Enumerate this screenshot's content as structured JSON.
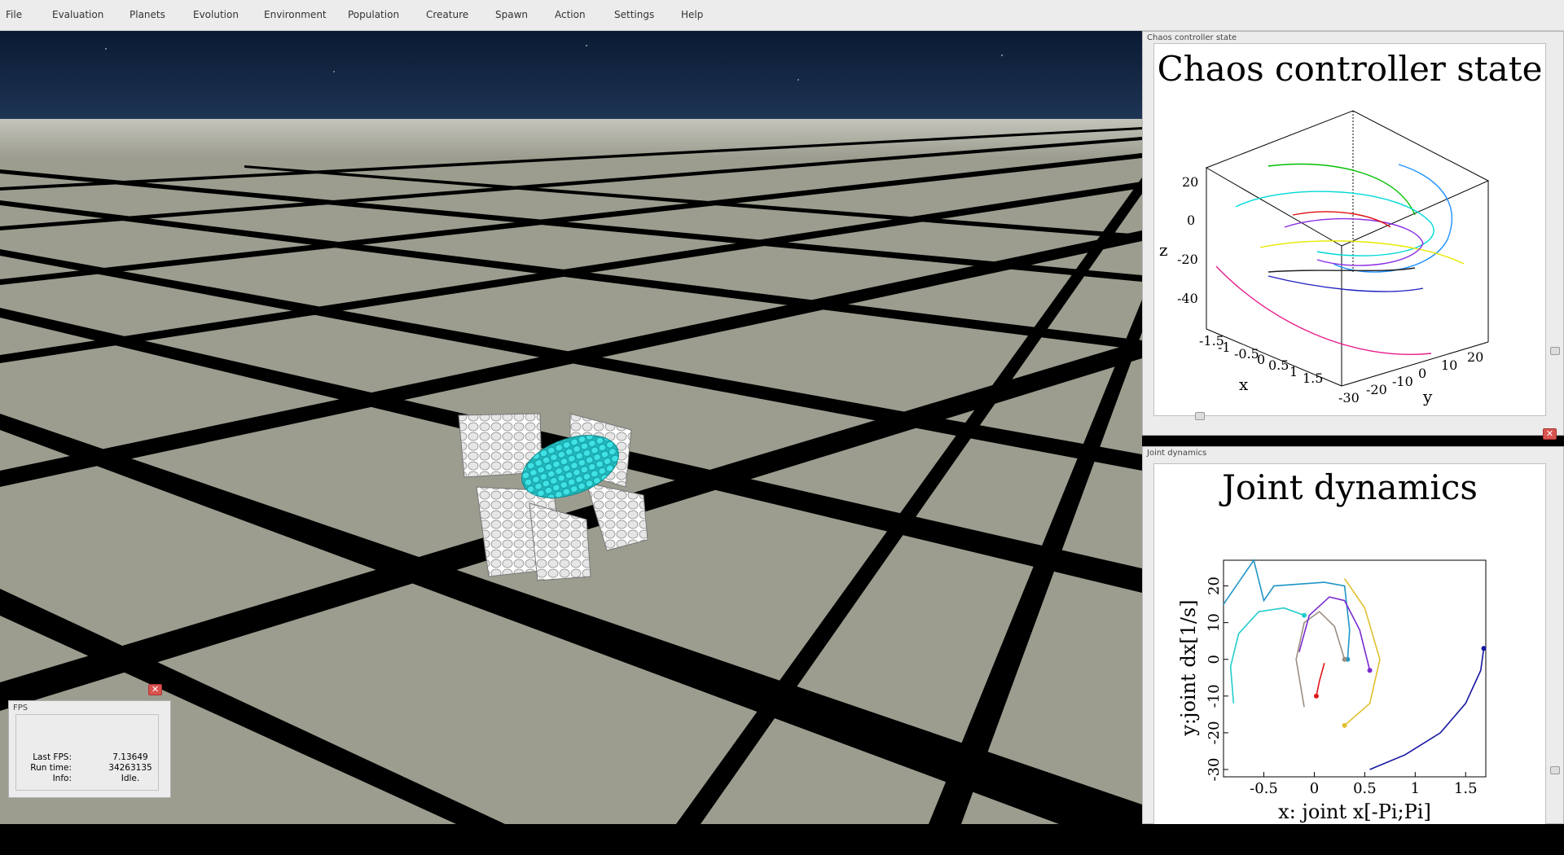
{
  "menu": {
    "items": [
      "File",
      "Evaluation",
      "Planets",
      "Evolution",
      "Environment",
      "Population",
      "Creature",
      "Spawn",
      "Action",
      "Settings",
      "Help"
    ]
  },
  "chaos_panel": {
    "window_title": "Chaos controller state",
    "plot_title": "Chaos controller state",
    "close_icon": "close-icon"
  },
  "joint_panel": {
    "window_title": "Joint dynamics",
    "plot_title": "Joint dynamics"
  },
  "fps_panel": {
    "title": "FPS",
    "rows": [
      {
        "label": "Last FPS:",
        "value": "7.13649"
      },
      {
        "label": "Run time:",
        "value": "34263135"
      },
      {
        "label": "Info:",
        "value": "Idle."
      }
    ]
  },
  "colors": {
    "floor": "#9c9d8f",
    "grid_lines": "#000000",
    "sky": "#0a1a33",
    "creature_body": "#2ec9cc",
    "panel_bg": "#ececec",
    "close_button": "#d9534f"
  },
  "chart_data": [
    {
      "type": "scatter",
      "title": "Chaos controller state",
      "projection": "3d",
      "xlabel": "x",
      "ylabel": "y",
      "zlabel": "z",
      "x_ticks": [
        "-1.5",
        "-1",
        "-0.5",
        "0",
        "0.5",
        "1",
        "1.5"
      ],
      "y_ticks": [
        "-30",
        "-20",
        "-10",
        "0",
        "10",
        "20"
      ],
      "z_ticks": [
        "20",
        "0",
        "-20",
        "-40"
      ],
      "grid": false,
      "series_colors": [
        "#00c000",
        "#1e90ff",
        "#e61e8c",
        "#00d8d8",
        "#e8e800",
        "#8a2be2",
        "#202020",
        "#1f1fbf",
        "#e01010"
      ]
    },
    {
      "type": "line",
      "title": "Joint dynamics",
      "xlabel": "x: joint x[-Pi;Pi]",
      "ylabel": "y:joint dx[1/s]",
      "xlim": [
        -0.9,
        1.7
      ],
      "ylim": [
        -32,
        27
      ],
      "x_ticks": [
        "-0.5",
        "0",
        "0.5",
        "1",
        "1.5"
      ],
      "y_ticks": [
        "20",
        "10",
        "0",
        "-10",
        "-20",
        "-30"
      ],
      "grid": false,
      "series": [
        {
          "color": "#1f96c8",
          "points": [
            [
              -0.9,
              15
            ],
            [
              -0.6,
              27
            ],
            [
              -0.5,
              16
            ],
            [
              -0.4,
              20
            ],
            [
              0.1,
              21
            ],
            [
              0.3,
              20
            ],
            [
              0.35,
              8
            ],
            [
              0.33,
              0
            ]
          ]
        },
        {
          "color": "#22cccc",
          "points": [
            [
              -0.8,
              -12
            ],
            [
              -0.83,
              -2
            ],
            [
              -0.75,
              7
            ],
            [
              -0.55,
              13
            ],
            [
              -0.3,
              14
            ],
            [
              -0.1,
              12
            ]
          ]
        },
        {
          "color": "#9a8f80",
          "points": [
            [
              -0.1,
              -13
            ],
            [
              -0.18,
              0
            ],
            [
              -0.1,
              10
            ],
            [
              0.05,
              13
            ],
            [
              0.2,
              9
            ],
            [
              0.3,
              0
            ]
          ]
        },
        {
          "color": "#7a2bd0",
          "points": [
            [
              -0.15,
              2
            ],
            [
              -0.05,
              12
            ],
            [
              0.15,
              17
            ],
            [
              0.3,
              16
            ],
            [
              0.45,
              8
            ],
            [
              0.55,
              -3
            ]
          ]
        },
        {
          "color": "#e0c030",
          "points": [
            [
              0.3,
              22
            ],
            [
              0.5,
              14
            ],
            [
              0.65,
              0
            ],
            [
              0.55,
              -12
            ],
            [
              0.3,
              -18
            ]
          ]
        },
        {
          "color": "#e01818",
          "points": [
            [
              0.1,
              -1
            ],
            [
              0.05,
              -6
            ],
            [
              0.02,
              -10
            ]
          ]
        },
        {
          "color": "#1515a0",
          "points": [
            [
              0.55,
              -30
            ],
            [
              0.9,
              -26
            ],
            [
              1.25,
              -20
            ],
            [
              1.5,
              -12
            ],
            [
              1.65,
              -3
            ],
            [
              1.68,
              3
            ]
          ]
        }
      ]
    }
  ]
}
